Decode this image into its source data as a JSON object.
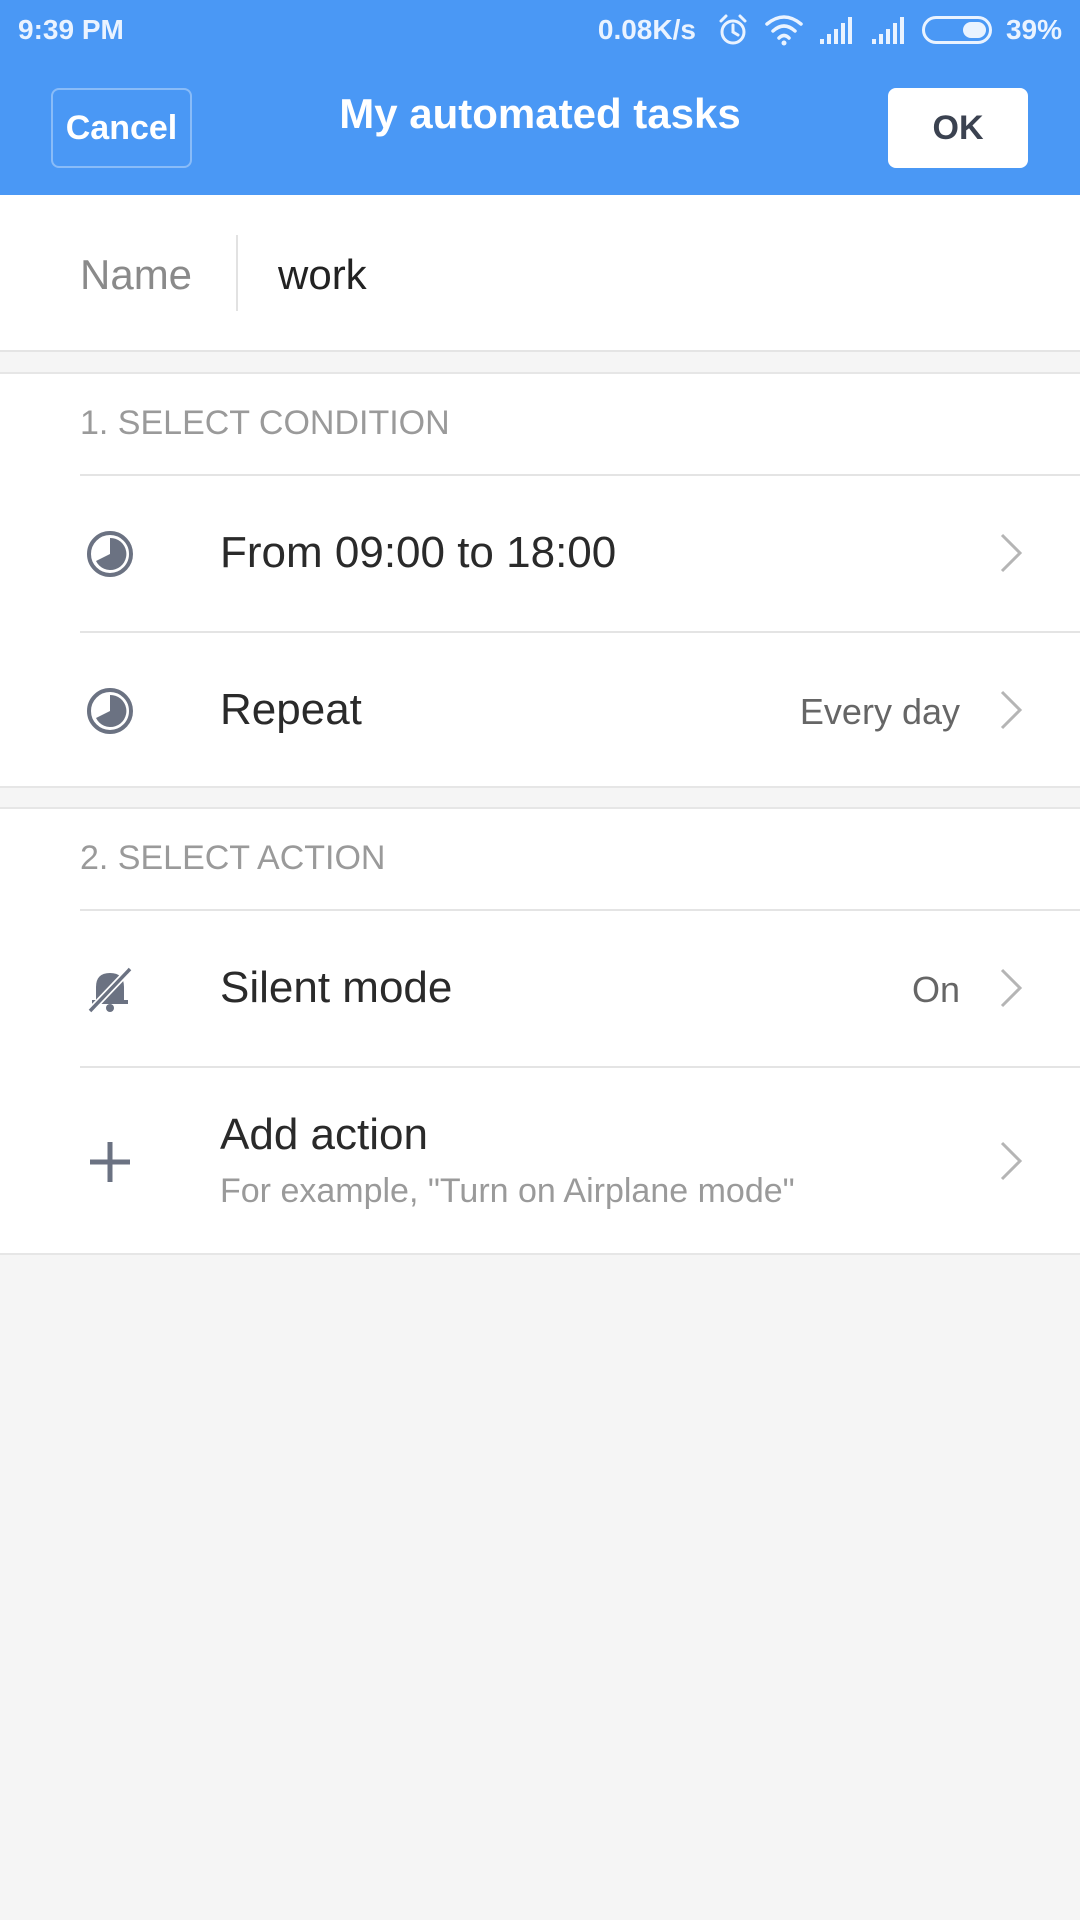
{
  "status_bar": {
    "time": "9:39 PM",
    "net_speed": "0.08K/s",
    "battery_percent": "39%",
    "battery_level": 0.39,
    "icons": [
      "alarm-icon",
      "wifi-icon",
      "signal-icon",
      "signal-icon",
      "battery-icon"
    ]
  },
  "header": {
    "title": "My automated tasks",
    "cancel_label": "Cancel",
    "ok_label": "OK",
    "bg_color": "#4a98f5"
  },
  "name_field": {
    "label": "Name",
    "value": "work"
  },
  "condition_section": {
    "heading": "1. SELECT CONDITION",
    "rows": [
      {
        "icon": "clock-icon",
        "label": "From 09:00 to 18:00",
        "value": ""
      },
      {
        "icon": "clock-icon",
        "label": "Repeat",
        "value": "Every day"
      }
    ]
  },
  "action_section": {
    "heading": "2. SELECT ACTION",
    "rows": [
      {
        "icon": "silent-bell-icon",
        "label": "Silent mode",
        "value": "On"
      },
      {
        "icon": "plus-icon",
        "label": "Add action",
        "sublabel": "For example, \"Turn on Airplane mode\""
      }
    ]
  }
}
